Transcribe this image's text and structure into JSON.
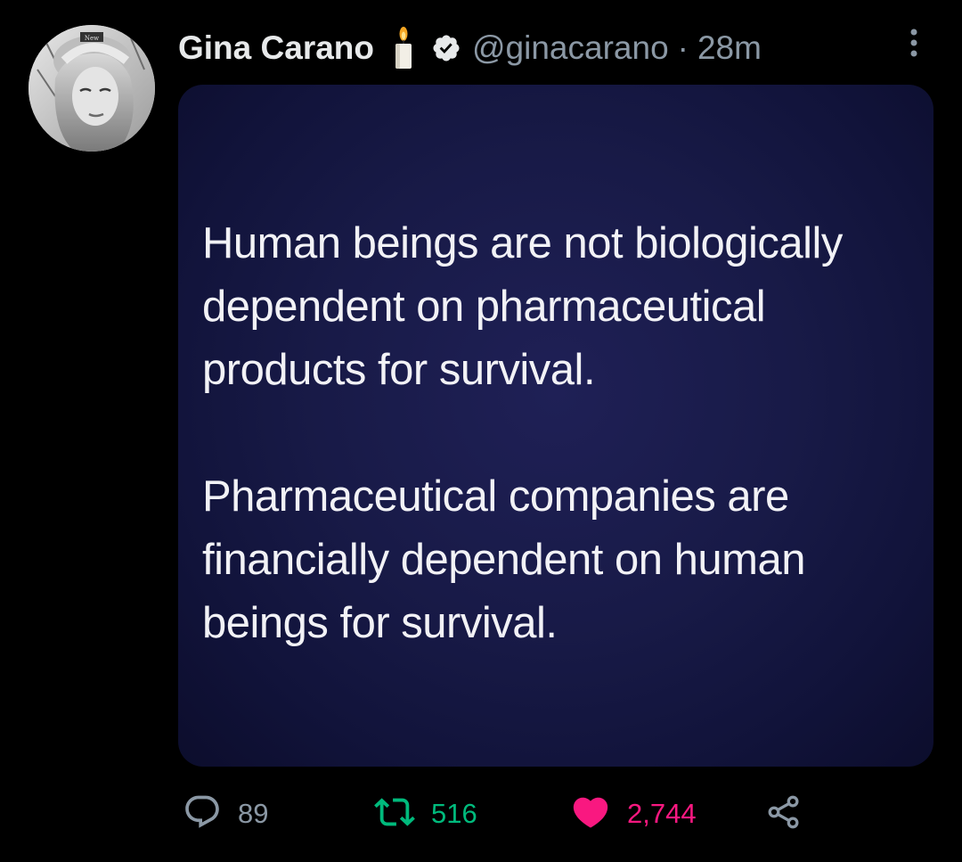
{
  "tweet": {
    "author": {
      "display_name": "Gina Carano",
      "handle": "@ginacarano",
      "verified": true,
      "name_emoji": "candle-icon"
    },
    "separator": "·",
    "timestamp": "28m",
    "media": {
      "paragraphs": [
        "Human beings are not biologically\ndependent on pharmaceutical\nproducts for survival.",
        "Pharmaceutical companies are\nfinancially dependent on human\nbeings for survival."
      ]
    },
    "actions": {
      "reply_count": "89",
      "retweet_count": "516",
      "like_count": "2,744",
      "liked": true,
      "retweeted": true
    }
  },
  "colors": {
    "background": "#000000",
    "text_primary": "#e7e9ea",
    "text_secondary": "#8b98a5",
    "retweet_green": "#00ba7c",
    "like_pink": "#f91880",
    "media_background": "#181a47"
  },
  "icons": {
    "more": "more-horizontal-icon",
    "reply": "reply-icon",
    "retweet": "retweet-icon",
    "like": "heart-icon",
    "share": "share-icon",
    "verified": "verified-badge-icon"
  }
}
